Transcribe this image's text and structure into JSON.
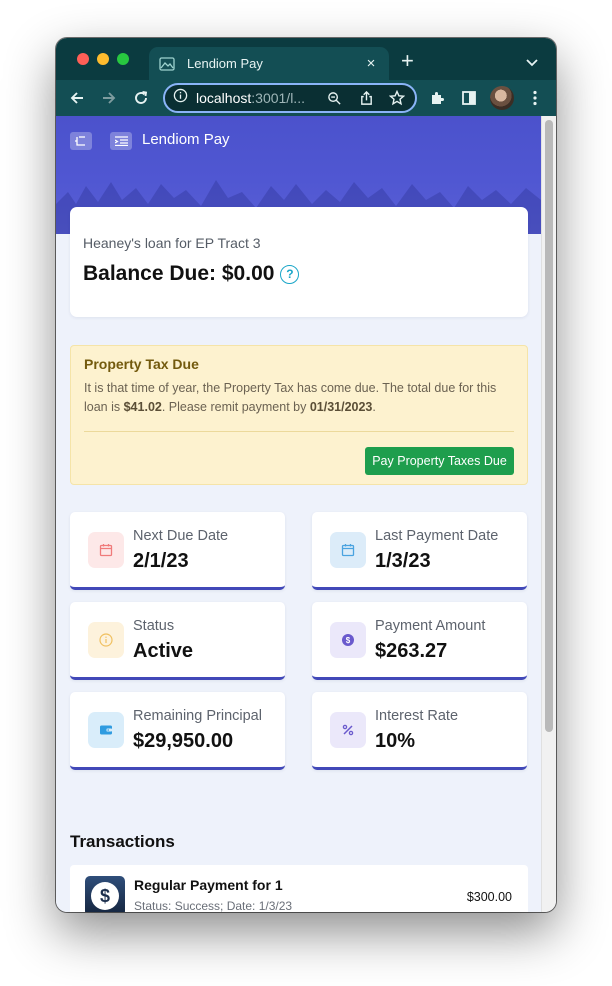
{
  "browser": {
    "tab_title": "Lendiom Pay",
    "tab_close": "×",
    "new_tab": "+",
    "url_host": "localhost",
    "url_rest": ":3001/l..."
  },
  "app": {
    "brand": "Lendiom Pay"
  },
  "loan": {
    "name": "Heaney's loan for EP Tract 3",
    "balance_label": "Balance Due: $0.00",
    "help": "?"
  },
  "tax_notice": {
    "title": "Property Tax Due",
    "body_1": "It is that time of year, the Property Tax has come due. The total due for this loan is ",
    "amount": "$41.02",
    "body_2": ". Please remit payment by ",
    "due_date": "01/31/2023",
    "body_3": ".",
    "button": "Pay Property Taxes Due"
  },
  "stats": {
    "next_due": {
      "label": "Next Due Date",
      "value": "2/1/23",
      "icon": "calendar-icon",
      "color": "#f07b7b",
      "bg": "#fde8e8"
    },
    "last_payment": {
      "label": "Last Payment Date",
      "value": "1/3/23",
      "icon": "calendar-icon",
      "color": "#4aa3e0",
      "bg": "#dcecf9"
    },
    "status": {
      "label": "Status",
      "value": "Active",
      "icon": "info-icon",
      "color": "#f0c060",
      "bg": "#fdf2dc"
    },
    "payment_amount": {
      "label": "Payment Amount",
      "value": "$263.27",
      "icon": "dollar-icon",
      "color": "#6a5acd",
      "bg": "#ebe8fa"
    },
    "remaining_principal": {
      "label": "Remaining Principal",
      "value": "$29,950.00",
      "icon": "wallet-icon",
      "color": "#2f9be0",
      "bg": "#d9edfa"
    },
    "interest_rate": {
      "label": "Interest Rate",
      "value": "10%",
      "icon": "percent-icon",
      "color": "#6a5acd",
      "bg": "#ebe8fa"
    }
  },
  "transactions": {
    "heading": "Transactions",
    "items": [
      {
        "title": "Regular Payment for 1",
        "subtitle": "Status: Success; Date: 1/3/23",
        "amount": "$300.00",
        "icon": "dollar-coin-icon"
      }
    ]
  }
}
